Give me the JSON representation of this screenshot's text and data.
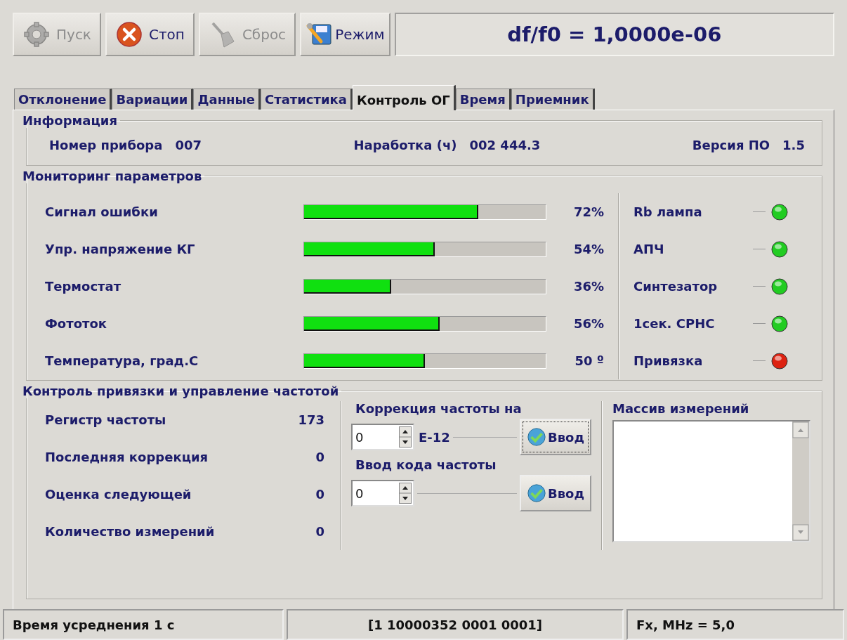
{
  "toolbar": {
    "buttons": [
      {
        "kind": "start",
        "label": "Пуск",
        "disabled": true
      },
      {
        "kind": "stop",
        "label": "Стоп",
        "disabled": false
      },
      {
        "kind": "reset",
        "label": "Сброс",
        "disabled": true
      },
      {
        "kind": "mode",
        "label": "Режим",
        "disabled": false
      }
    ],
    "display": "df/f0 = 1,0000e-06"
  },
  "tabs": [
    {
      "label": "Отклонение",
      "selected": false
    },
    {
      "label": "Вариации",
      "selected": false
    },
    {
      "label": "Данные",
      "selected": false
    },
    {
      "label": "Статистика",
      "selected": false
    },
    {
      "label": "Контроль ОГ",
      "selected": true
    },
    {
      "label": "Время",
      "selected": false
    },
    {
      "label": "Приемник",
      "selected": false
    }
  ],
  "info": {
    "title": "Информация",
    "items": [
      {
        "label": "Номер прибора",
        "value": "007"
      },
      {
        "label": "Наработка (ч)",
        "value": "002 444.3"
      },
      {
        "label": "Версия ПО",
        "value": "1.5"
      }
    ]
  },
  "monitoring": {
    "title": "Мониторинг параметров",
    "params": [
      {
        "label": "Сигнал ошибки",
        "level": 0.72,
        "reading": "72%"
      },
      {
        "label": "Упр. напряжение КГ",
        "level": 0.54,
        "reading": "54%"
      },
      {
        "label": "Термостат",
        "level": 0.36,
        "reading": "36%"
      },
      {
        "label": "Фототок",
        "level": 0.56,
        "reading": "56%"
      },
      {
        "label": "Температура, град.С",
        "level": 0.5,
        "reading": "50 º"
      }
    ],
    "indicators": [
      {
        "label": "Rb лампа",
        "color": "#22cc22"
      },
      {
        "label": "АПЧ",
        "color": "#22cc22"
      },
      {
        "label": "Синтезатор",
        "color": "#22cc22"
      },
      {
        "label": "1сек. СРНС",
        "color": "#22cc22"
      },
      {
        "label": "Привязка",
        "color": "#dd2211"
      }
    ]
  },
  "control": {
    "title": "Контроль привязки и управление частотой",
    "stats": [
      {
        "label": "Регистр частоты",
        "value": "173"
      },
      {
        "label": "Последняя коррекция",
        "value": "0"
      },
      {
        "label": "Оценка следующей",
        "value": "0"
      },
      {
        "label": "Количество измерений",
        "value": "0"
      }
    ],
    "correction": {
      "title": "Коррекция частоты на",
      "value": "0",
      "unit": "E-12",
      "button": "Ввод",
      "focused": true
    },
    "code": {
      "title": "Ввод кода частоты",
      "value": "0",
      "button": "Ввод",
      "focused": false
    },
    "measurements": {
      "title": "Массив измерений"
    }
  },
  "status_bar": [
    "Время усреднения 1 с",
    "[1  10000352 0001 0001]",
    "Fx, MHz = 5,0"
  ]
}
